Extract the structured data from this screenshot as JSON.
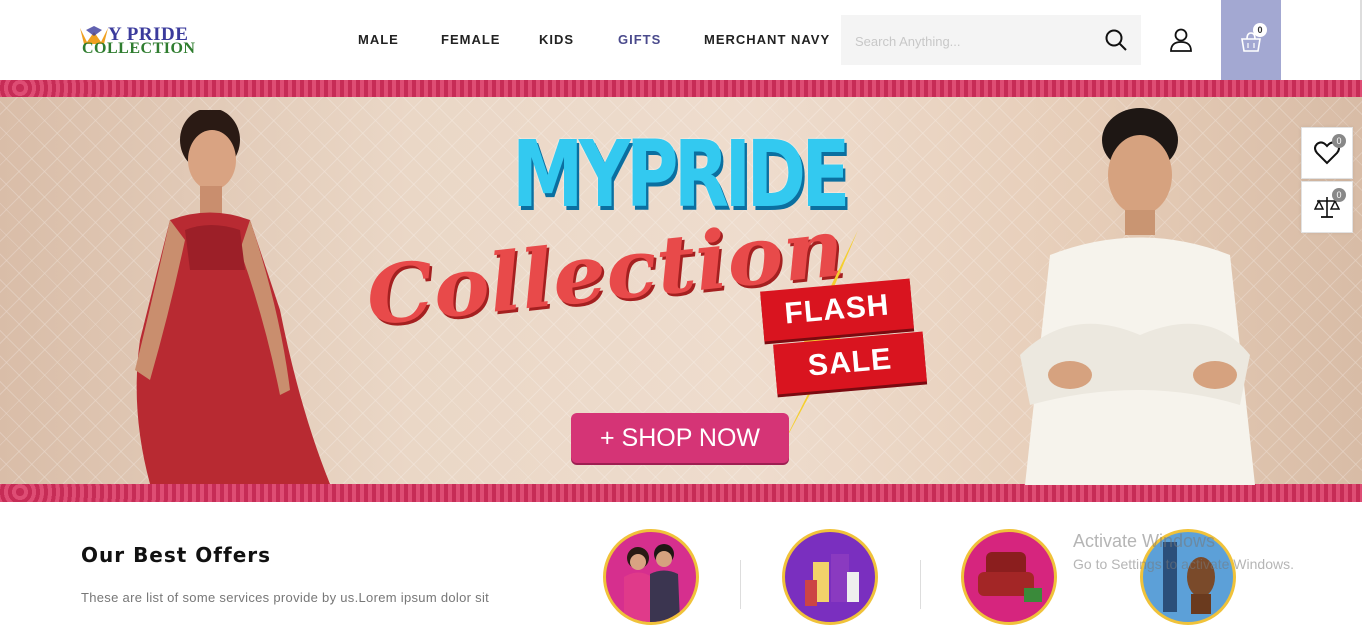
{
  "logo": {
    "line1": "Y PRIDE",
    "line2": "COLLECTION"
  },
  "nav": [
    {
      "label": "MALE",
      "active": false
    },
    {
      "label": "FEMALE",
      "active": false
    },
    {
      "label": "KIDS",
      "active": false
    },
    {
      "label": "GIFTS",
      "active": true
    },
    {
      "label": "MERCHANT NAVY",
      "active": false
    }
  ],
  "search": {
    "placeholder": "Search Anything..."
  },
  "cart": {
    "count": "0"
  },
  "wishlist": {
    "count": "0"
  },
  "compare": {
    "count": "0"
  },
  "banner": {
    "title": "MYPRIDE",
    "script": "Collection",
    "flash": "FLASH",
    "sale": "SALE",
    "shop_button": "+ SHOP NOW"
  },
  "offers": {
    "title": "Our Best Offers",
    "description": "These are list of some services provide by us.Lorem ipsum dolor sit"
  },
  "watermark": {
    "line1": "Activate Windows",
    "line2": "Go to Settings to activate Windows."
  },
  "colors": {
    "cart_bg": "#a3a8d2",
    "gifts_active": "#4a4a8c",
    "banner_strip": "#d93a64",
    "shop_button": "#d53476"
  }
}
